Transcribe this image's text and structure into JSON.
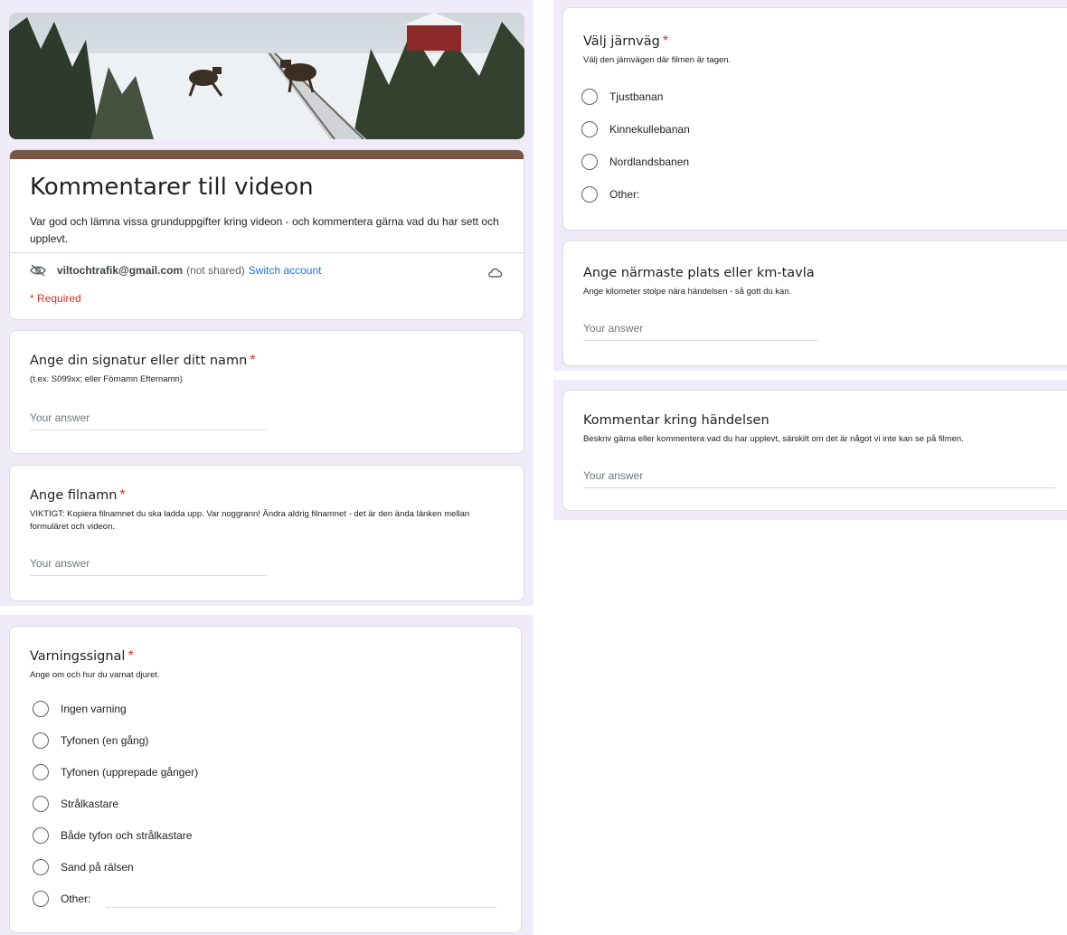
{
  "header": {
    "title": "Kommentarer till videon",
    "description": "Var god och lämna vissa grunduppgifter kring videon - och kommentera gärna vad du har sett och upplevt.",
    "account_email": "viltochtrafik@gmail.com",
    "not_shared": "(not shared)",
    "switch_account": "Switch account",
    "required_note": "* Required",
    "accent_color": "#795548"
  },
  "questions": {
    "signature": {
      "title": "Ange din signatur eller ditt namn",
      "required": "*",
      "help": "(t.ex. S099xx; eller Förnamn Efternamn)",
      "placeholder": "Your answer"
    },
    "filename": {
      "title": "Ange filnamn",
      "required": "*",
      "help": "VIKTIGT: Kopiera filnamnet du ska ladda upp. Var noggrann! Ändra aldrig filnamnet - det är den ända länken mellan formuläret och videon.",
      "placeholder": "Your answer"
    },
    "warning": {
      "title": "Varningssignal",
      "required": "*",
      "help": "Ange om och hur du varnat djuret.",
      "options": [
        "Ingen varning",
        "Tyfonen (en gång)",
        "Tyfonen (upprepade gånger)",
        "Strålkastare",
        "Både tyfon och strålkastare",
        "Sand på rälsen",
        "Other:"
      ]
    },
    "railway": {
      "title": "Välj järnväg",
      "required": "*",
      "help": "Välj den järnvägen där filmen är tagen.",
      "options": [
        "Tjustbanan",
        "Kinnekullebanan",
        "Nordlandsbanen",
        "Other:"
      ]
    },
    "location": {
      "title": "Ange närmaste plats eller km-tavla",
      "help": "Ange kilometer stolpe nära händelsen - så gott du kan.",
      "placeholder": "Your answer"
    },
    "comment": {
      "title": "Kommentar kring händelsen",
      "help": "Beskriv gärna eller kommentera vad du har upplevt, särskilt om det är något vi inte kan se på filmen.",
      "placeholder": "Your answer"
    }
  }
}
